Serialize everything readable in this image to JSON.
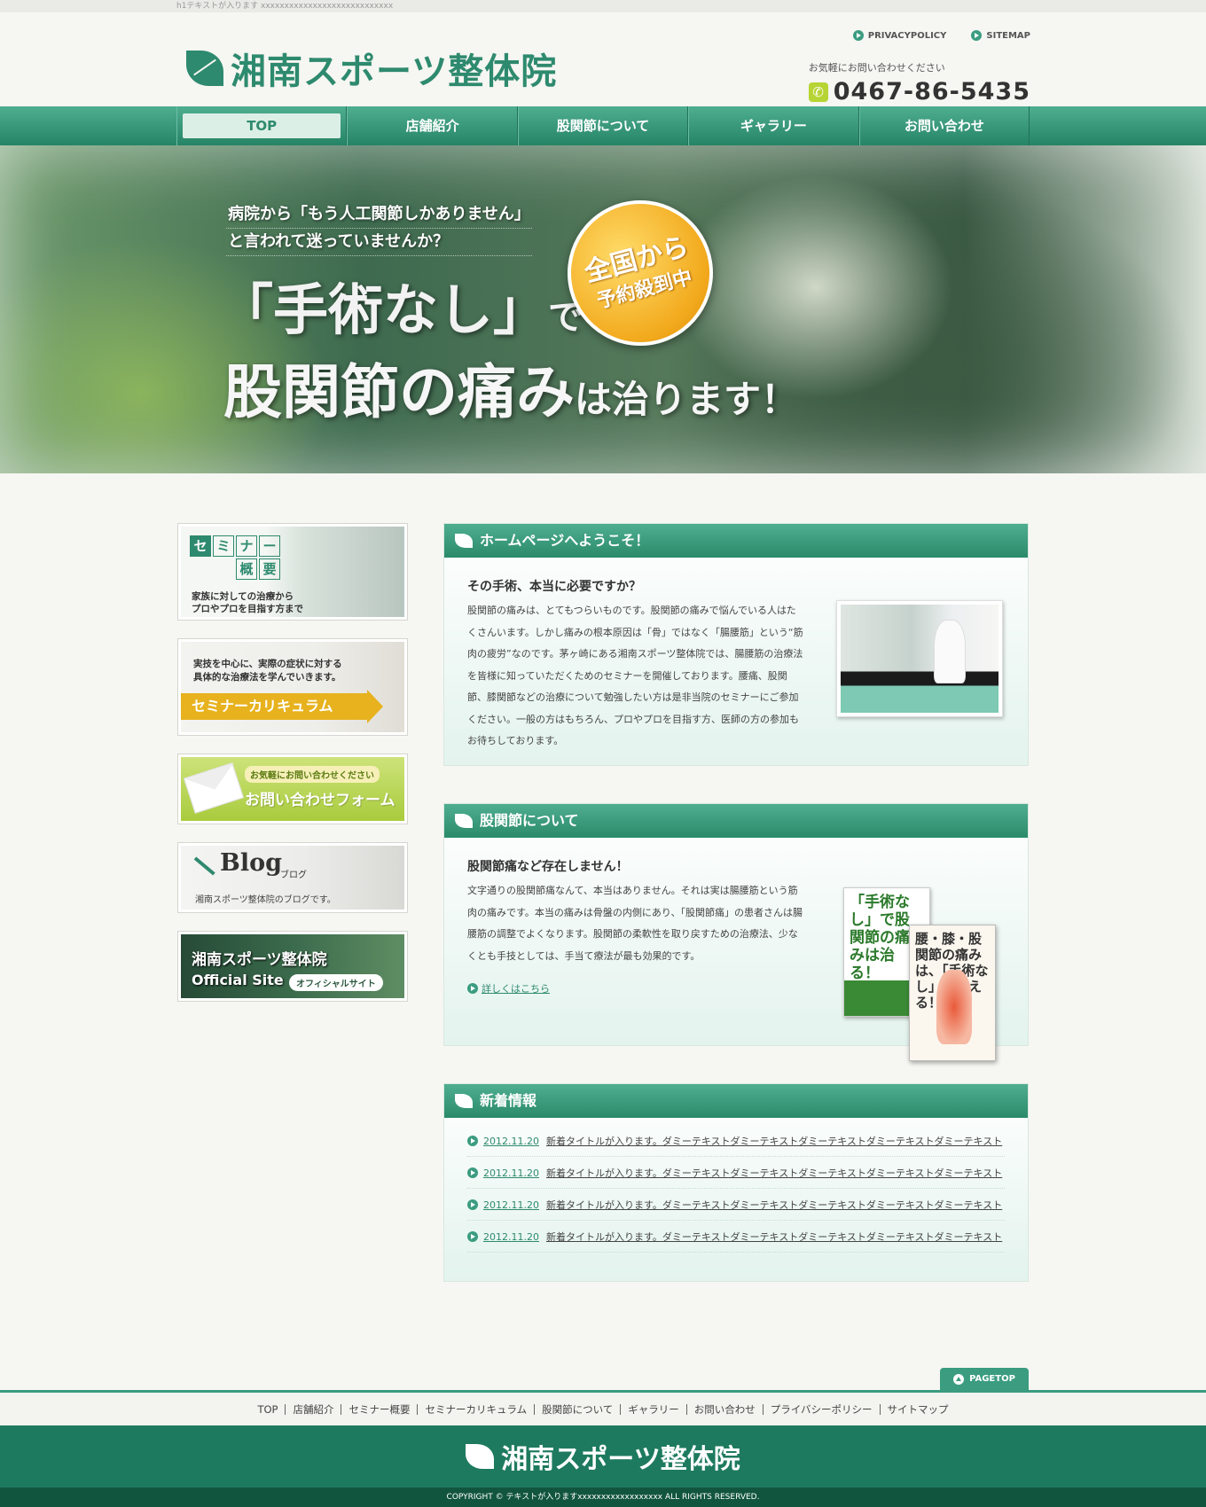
{
  "topbar": {
    "h1_text": "h1テキストが入ります xxxxxxxxxxxxxxxxxxxxxxxxxxxx"
  },
  "header": {
    "logo_text": "湘南スポーツ整体院",
    "privacy_label": "PRIVACYPOLICY",
    "sitemap_label": "SITEMAP",
    "contact_note": "お気軽にお問い合わせください",
    "phone": "0467-86-5435"
  },
  "nav": {
    "items": [
      {
        "label": "TOP"
      },
      {
        "label": "店舗紹介"
      },
      {
        "label": "股関節について"
      },
      {
        "label": "ギャラリー"
      },
      {
        "label": "お問い合わせ"
      }
    ]
  },
  "hero": {
    "line1": "病院から「もう人工関節しかありません」",
    "line2": "と言われて迷っていませんか？",
    "main1": "「手術なし」",
    "main1_suffix": "で",
    "main2": "股関節の痛み",
    "main2_suffix": "は治ります！",
    "badge1": "全国から",
    "badge2": "予約殺到中"
  },
  "sidebar": {
    "seminar": {
      "cells": [
        "セ",
        "ミ",
        "ナ",
        "ー",
        "",
        "",
        "概",
        "要"
      ],
      "caption1": "家族に対しての治療から",
      "caption2": "プロやプロを目指す方まで"
    },
    "curriculum": {
      "text1": "実技を中心に、実際の症状に対する",
      "text2": "具体的な治療法を学んでいきます。",
      "label": "セミナーカリキュラム"
    },
    "form": {
      "small": "お気軽にお問い合わせください",
      "big": "お問い合わせフォーム"
    },
    "blog": {
      "title": "Blog",
      "kana": "ブログ",
      "desc": "湘南スポーツ整体院のブログです。"
    },
    "official": {
      "title": "湘南スポーツ整体院",
      "en": "Official Site",
      "badge": "オフィシャルサイト"
    }
  },
  "welcome": {
    "heading": "ホームページへようこそ！",
    "title": "その手術、本当に必要ですか？",
    "text": "股関節の痛みは、とてもつらいものです。股関節の痛みで悩んでいる人はたくさんいます。しかし痛みの根本原因は「骨」ではなく「腸腰筋」という“筋肉の疲労”なのです。茅ヶ崎にある湘南スポーツ整体院では、腸腰筋の治療法を皆様に知っていただくためのセミナーを開催しております。腰痛、股関節、膝関節などの治療について勉強したい方は是非当院のセミナーにご参加ください。一般の方はもちろん、プロやプロを目指す方、医師の方の参加もお待ちしております。"
  },
  "hip": {
    "heading": "股関節について",
    "title": "股関節痛など存在しません！",
    "text": "文字通りの股関節痛なんて、本当はありません。それは実は腸腰筋という筋肉の痛みです。本当の痛みは骨盤の内側にあり、「股関節痛」の患者さんは腸腰筋の調整でよくなります。股関節の柔軟性を取り戻すための治療法、少なくとも手技としては、手当て療法が最も効果的です。",
    "more_link": "詳しくはこちら",
    "book1_title": "「手術なし」で股関節の痛みは治る！",
    "book2_title": "腰・膝・股関節の痛みは、「手術なし」で消える！"
  },
  "news": {
    "heading": "新着情報",
    "items": [
      {
        "date": "2012.11.20",
        "text": "新着タイトルが入ります。ダミーテキストダミーテキストダミーテキストダミーテキストダミーテキスト"
      },
      {
        "date": "2012.11.20",
        "text": "新着タイトルが入ります。ダミーテキストダミーテキストダミーテキストダミーテキストダミーテキスト"
      },
      {
        "date": "2012.11.20",
        "text": "新着タイトルが入ります。ダミーテキストダミーテキストダミーテキストダミーテキストダミーテキスト"
      },
      {
        "date": "2012.11.20",
        "text": "新着タイトルが入ります。ダミーテキストダミーテキストダミーテキストダミーテキストダミーテキスト"
      }
    ]
  },
  "footer": {
    "pagetop": "PAGETOP",
    "links": [
      "TOP",
      "店舗紹介",
      "セミナー概要",
      "セミナーカリキュラム",
      "股関節について",
      "ギャラリー",
      "お問い合わせ",
      "プライバシーポリシー",
      "サイトマップ"
    ],
    "logo": "湘南スポーツ整体院",
    "copyright": "COPYRIGHT © テキストが入りますxxxxxxxxxxxxxxxxxx ALL RIGHTS RESERVED."
  },
  "colors": {
    "accent": "#2e8a6e",
    "nav": "#3b9c80",
    "yellow": "#e7b21e",
    "lime": "#b6d433"
  }
}
